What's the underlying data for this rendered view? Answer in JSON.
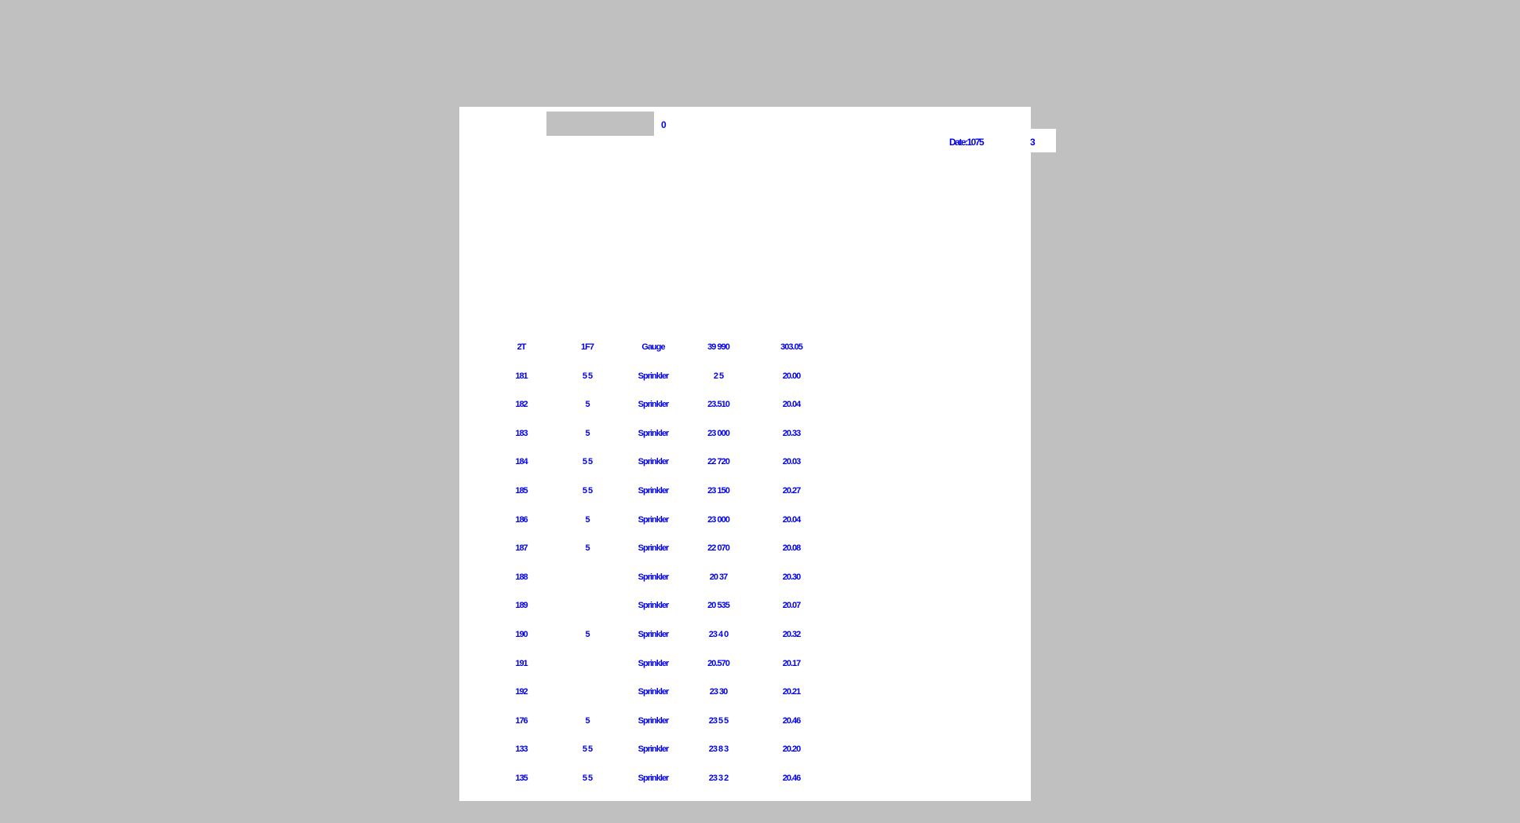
{
  "header": {
    "top_label": "0",
    "date_text": "Date:1075",
    "page_number": "3"
  },
  "table": {
    "rows": [
      {
        "c1": "2T",
        "c2": "1F7",
        "c3": "Gauge",
        "c4": "39 990",
        "c5": "303.05"
      },
      {
        "c1": "181",
        "c2": "5 5",
        "c3": "Sprinkler",
        "c4": "2 5",
        "c5": "20.00"
      },
      {
        "c1": "182",
        "c2": "5",
        "c3": "Sprinkler",
        "c4": "23.510",
        "c5": "20.04"
      },
      {
        "c1": "183",
        "c2": "5",
        "c3": "Sprinkler",
        "c4": "23 000",
        "c5": "20.33"
      },
      {
        "c1": "184",
        "c2": "5 5",
        "c3": "Sprinkler",
        "c4": "22 720",
        "c5": "20.03"
      },
      {
        "c1": "185",
        "c2": "5 5",
        "c3": "Sprinkler",
        "c4": "23 150",
        "c5": "20.27"
      },
      {
        "c1": "186",
        "c2": "5",
        "c3": "Sprinkler",
        "c4": "23 000",
        "c5": "20.04"
      },
      {
        "c1": "187",
        "c2": "5",
        "c3": "Sprinkler",
        "c4": "22 070",
        "c5": "20.08"
      },
      {
        "c1": "188",
        "c2": "",
        "c3": "Sprinkler",
        "c4": "20 37",
        "c5": "20.30"
      },
      {
        "c1": "189",
        "c2": "",
        "c3": "Sprinkler",
        "c4": "20 535",
        "c5": "20.07"
      },
      {
        "c1": "190",
        "c2": "5",
        "c3": "Sprinkler",
        "c4": "23 4 0",
        "c5": "20.32"
      },
      {
        "c1": "191",
        "c2": "",
        "c3": "Sprinkler",
        "c4": "20.570",
        "c5": "20.17"
      },
      {
        "c1": "192",
        "c2": "",
        "c3": "Sprinkler",
        "c4": "23 30",
        "c5": "20.21"
      },
      {
        "c1": "176",
        "c2": "5",
        "c3": "Sprinkler",
        "c4": "23 5 5",
        "c5": "20.46"
      },
      {
        "c1": "133",
        "c2": "5 5",
        "c3": "Sprinkler",
        "c4": "23 8 3",
        "c5": "20.20"
      },
      {
        "c1": "135",
        "c2": "5 5",
        "c3": "Sprinkler",
        "c4": "23 3 2",
        "c5": "20.46"
      }
    ]
  }
}
